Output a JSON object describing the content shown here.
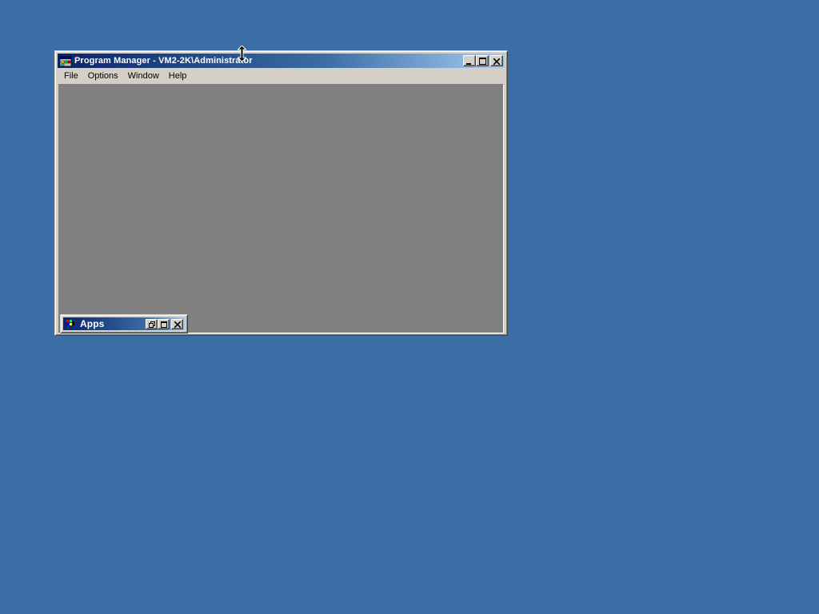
{
  "desktop": {
    "background_color": "#3a6ea5"
  },
  "window": {
    "title": "Program Manager - VM2-2K\\Administrator",
    "icon": "program-manager-icon",
    "controls": {
      "minimize": "minimize-icon",
      "maximize": "maximize-icon",
      "close": "close-icon"
    }
  },
  "menubar": {
    "items": [
      {
        "label": "File"
      },
      {
        "label": "Options"
      },
      {
        "label": "Window"
      },
      {
        "label": "Help"
      }
    ]
  },
  "mdi_child": {
    "title": "Apps",
    "icon": "program-group-icon",
    "controls": {
      "restore": "restore-icon",
      "maximize": "maximize-icon",
      "close": "close-icon"
    }
  },
  "colors": {
    "title_active_start": "#0a246a",
    "title_active_end": "#a6caf0",
    "client_background": "#808080",
    "face": "#d4d0c8"
  }
}
